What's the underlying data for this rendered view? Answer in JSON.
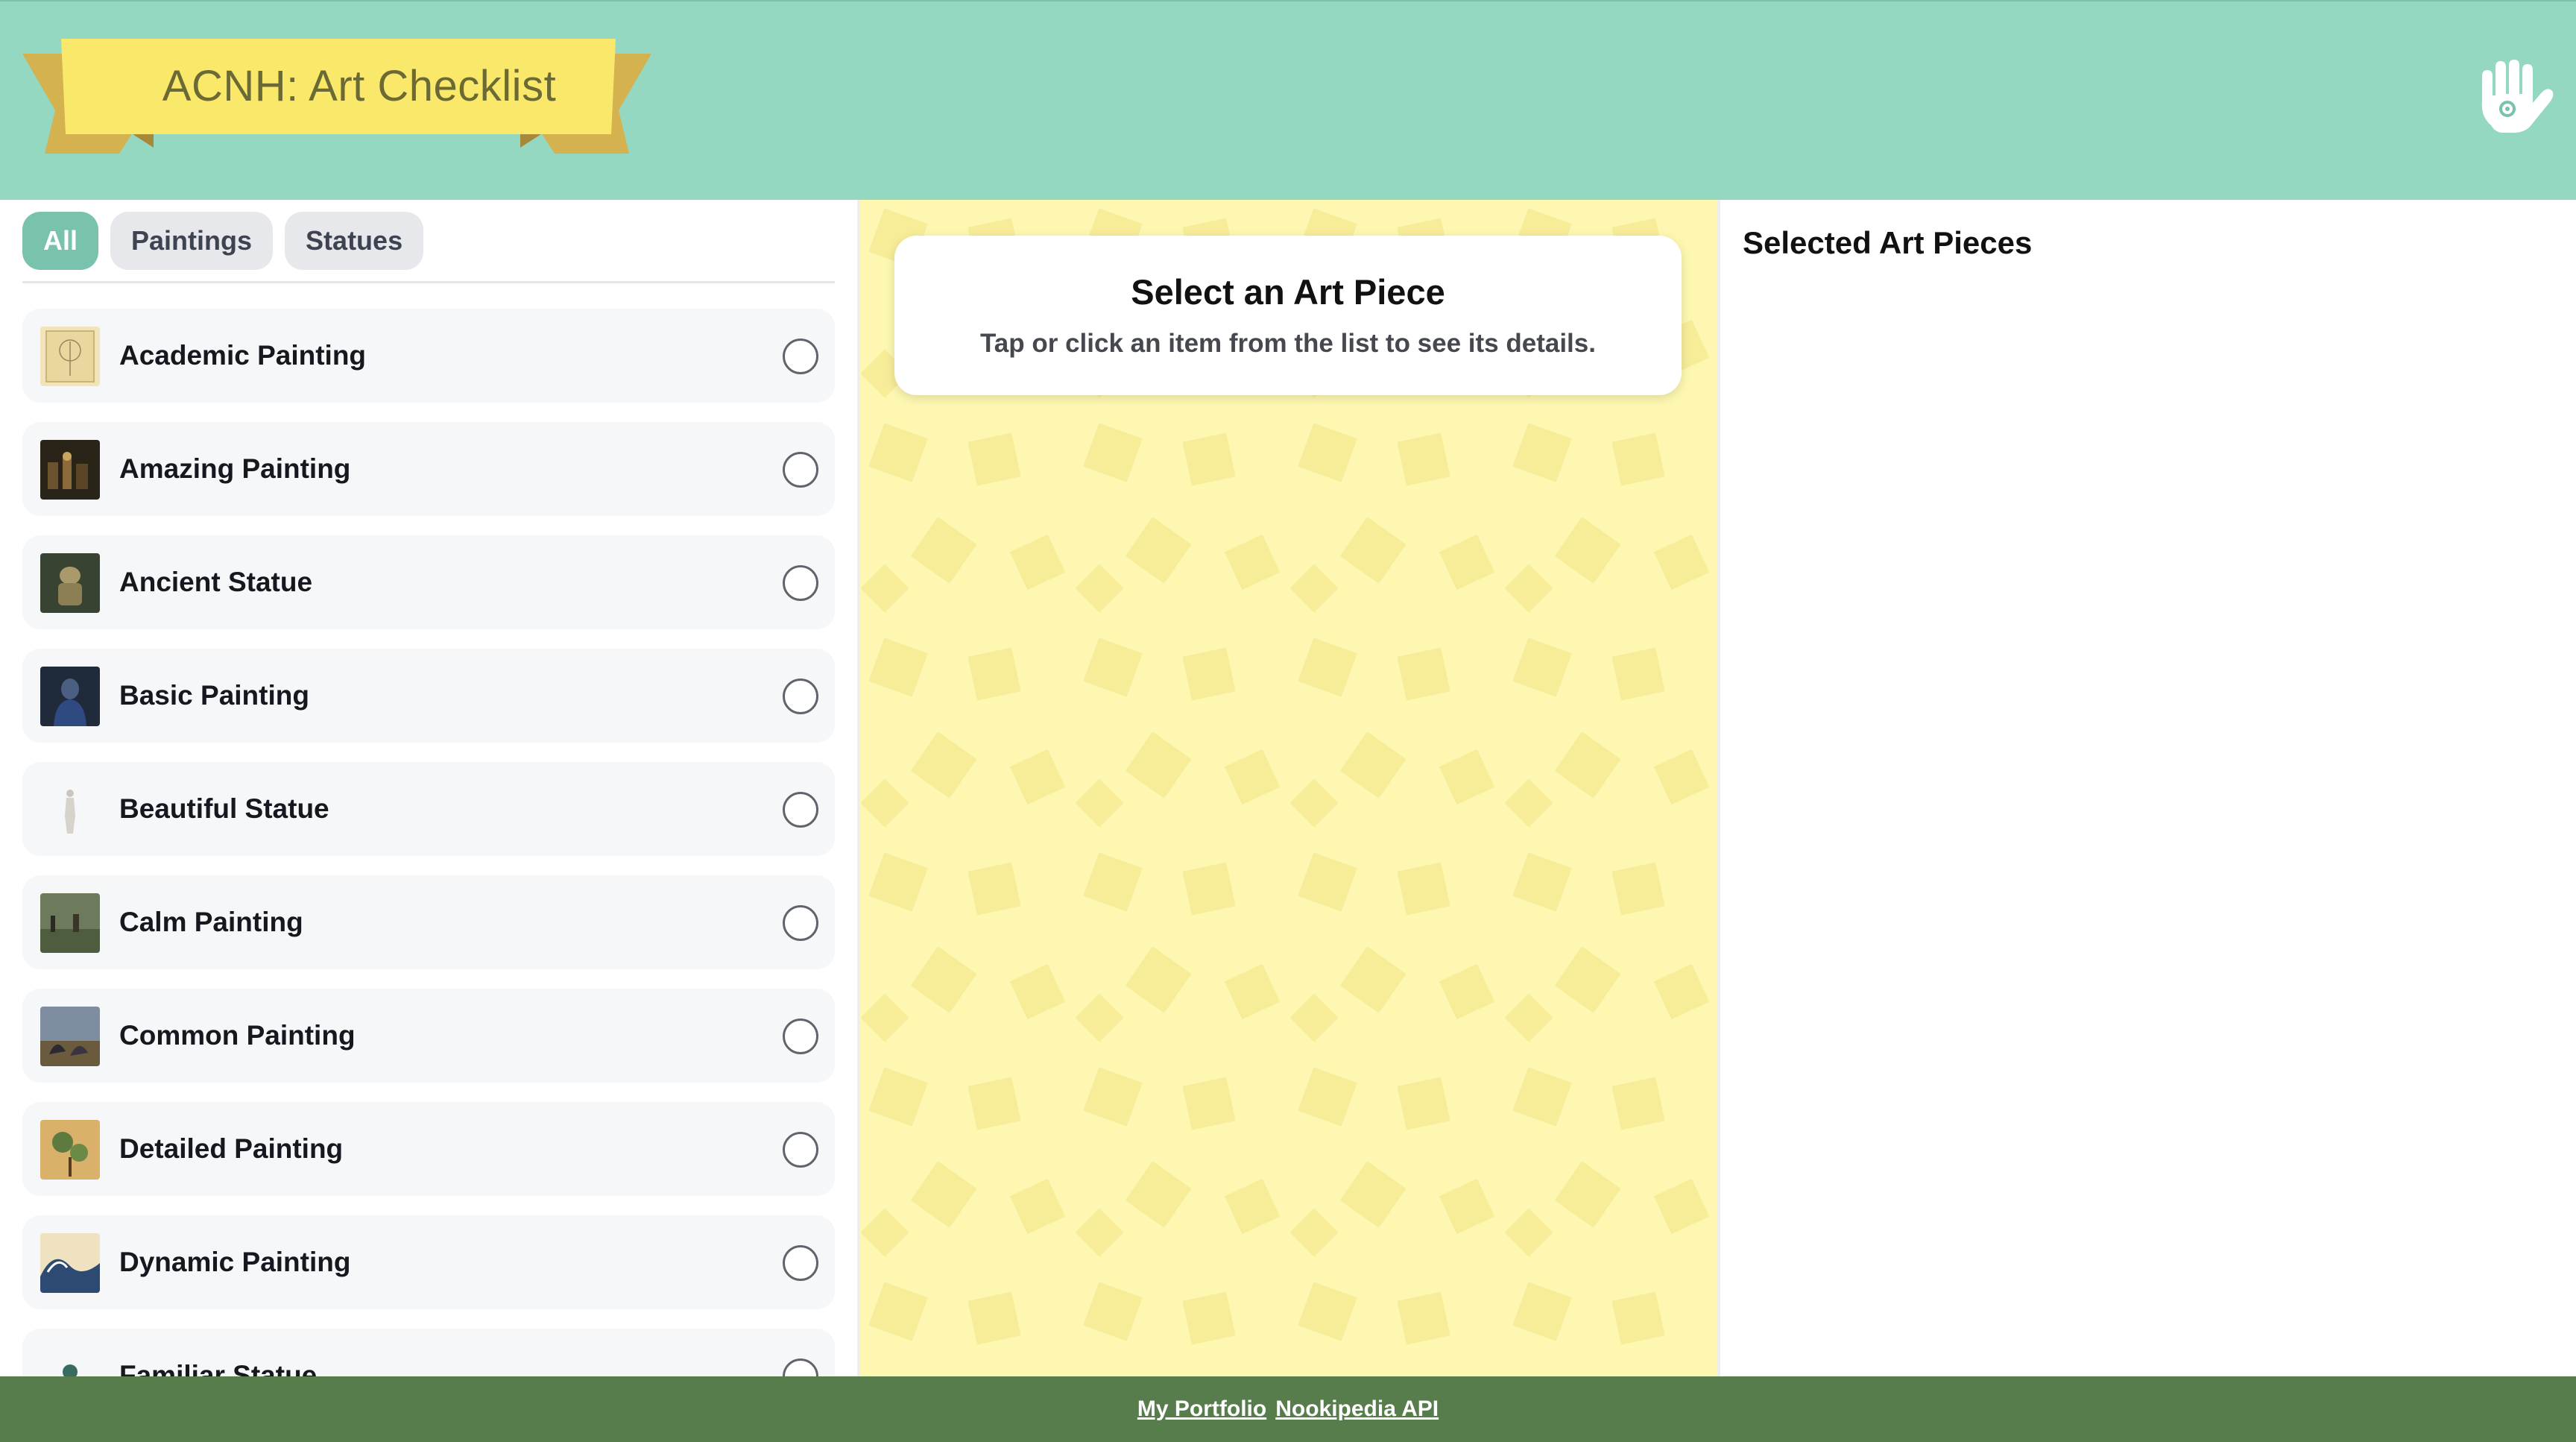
{
  "header": {
    "title": "ACNH: Art Checklist",
    "hand_icon": "hand-icon"
  },
  "filters": [
    {
      "label": "All",
      "active": true
    },
    {
      "label": "Paintings",
      "active": false
    },
    {
      "label": "Statues",
      "active": false
    }
  ],
  "art_items": [
    {
      "name": "Academic Painting",
      "checked": false
    },
    {
      "name": "Amazing Painting",
      "checked": false
    },
    {
      "name": "Ancient Statue",
      "checked": false
    },
    {
      "name": "Basic Painting",
      "checked": false
    },
    {
      "name": "Beautiful Statue",
      "checked": false
    },
    {
      "name": "Calm Painting",
      "checked": false
    },
    {
      "name": "Common Painting",
      "checked": false
    },
    {
      "name": "Detailed Painting",
      "checked": false
    },
    {
      "name": "Dynamic Painting",
      "checked": false
    },
    {
      "name": "Familiar Statue",
      "checked": false
    }
  ],
  "details": {
    "title": "Select an Art Piece",
    "subtitle": "Tap or click an item from the list to see its details."
  },
  "selected": {
    "title": "Selected Art Pieces"
  },
  "footer": {
    "links": [
      "My Portfolio",
      "Nookipedia API"
    ]
  },
  "colors": {
    "header_bg": "#95d8c2",
    "banner_yellow": "#fae86b",
    "banner_ribbon": "#d3b24f",
    "filter_active": "#78c2ae",
    "middle_bg": "#fdf7b1",
    "footer_bg": "#587d4d"
  }
}
